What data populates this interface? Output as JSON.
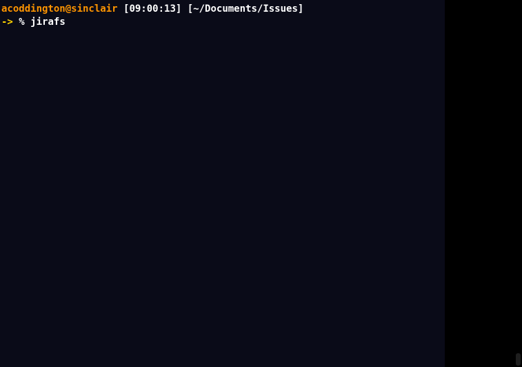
{
  "prompt": {
    "user_host": "acoddington@sinclair",
    "time": "[09:00:13]",
    "path": "[~/Documents/Issues]",
    "arrow": "->",
    "percent": "%",
    "command": "jirafs"
  }
}
